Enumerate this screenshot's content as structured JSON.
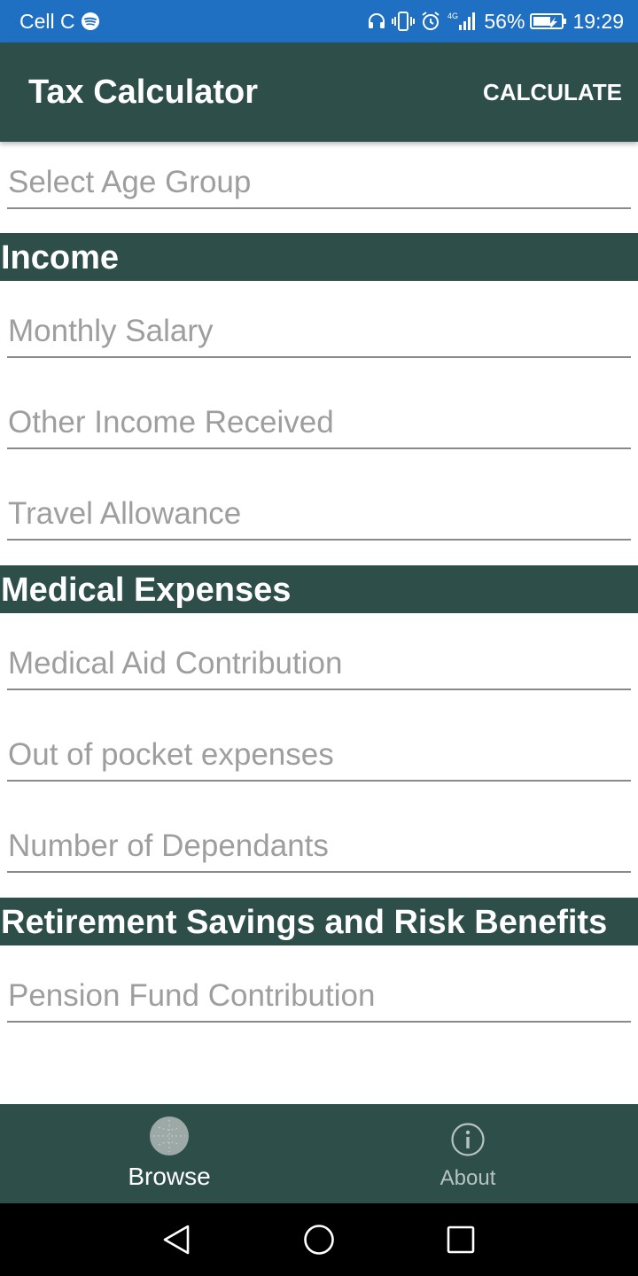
{
  "status_bar": {
    "carrier": "Cell C",
    "network": "4G",
    "battery": "56%",
    "time": "19:29"
  },
  "app_bar": {
    "title": "Tax Calculator",
    "action": "CALCULATE"
  },
  "form": {
    "age_group": {
      "placeholder": "Select Age Group",
      "value": ""
    },
    "sections": {
      "income": "Income",
      "medical": "Medical Expenses",
      "retirement": "Retirement Savings and Risk Benefits"
    },
    "fields": {
      "monthly_salary": "Monthly Salary",
      "other_income": "Other Income Received",
      "travel_allowance": "Travel Allowance",
      "medical_aid": "Medical Aid Contribution",
      "out_of_pocket": "Out of pocket expenses",
      "dependants": "Number of Dependants",
      "pension_fund": "Pension Fund Contribution"
    }
  },
  "bottom_nav": {
    "items": [
      {
        "label": "Browse",
        "icon": "globe-icon",
        "active": true
      },
      {
        "label": "About",
        "icon": "info-icon",
        "active": false
      }
    ]
  },
  "colors": {
    "status_bar": "#1f6fc3",
    "primary": "#2e4e4a",
    "hint": "#9e9e9e",
    "underline": "#8a8a8a"
  }
}
